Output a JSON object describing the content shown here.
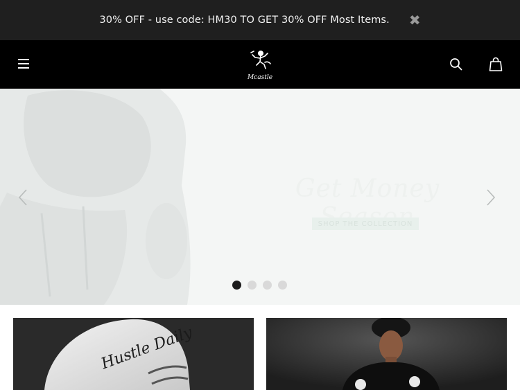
{
  "announcement": {
    "text": "30% OFF - use code: HM30 TO GET 30% OFF Most Items.",
    "close_icon": "close-icon"
  },
  "header": {
    "menu_icon": "hamburger-menu-icon",
    "logo_text": "Mcastle",
    "search_icon": "search-icon",
    "cart_icon": "shopping-bag-icon"
  },
  "hero": {
    "headline": "Get Money Season",
    "cta_label": "SHOP THE COLLECTION",
    "slide_count": 4,
    "active_slide": 1
  },
  "collections": {
    "left_caption": "Hustle Daily"
  },
  "colors": {
    "announce_bg": "#1f1f1f",
    "header_bg": "#000000",
    "hero_bg": "#f4f6f5",
    "dot_active": "#1c1c1c",
    "dot_inactive": "#d9d9d9"
  }
}
